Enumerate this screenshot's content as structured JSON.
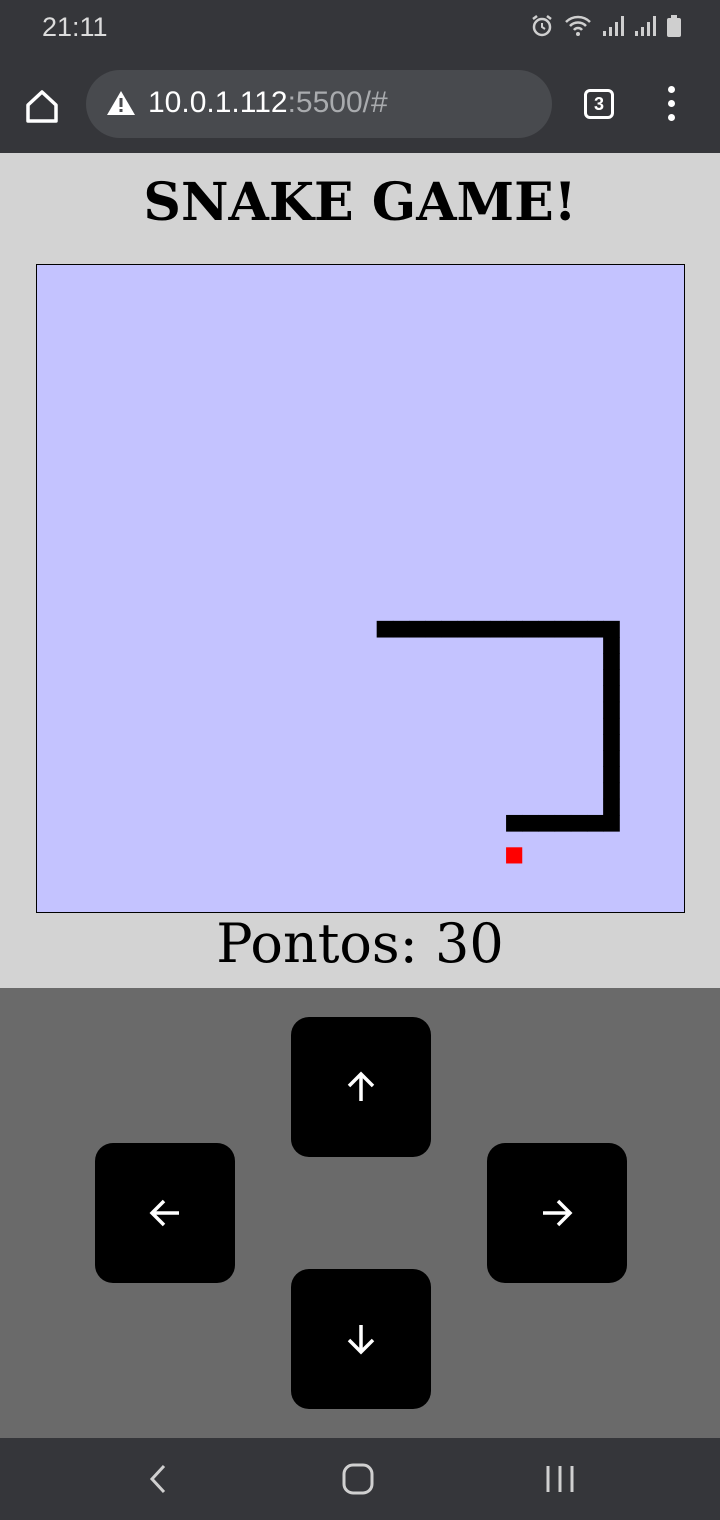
{
  "status_bar": {
    "time": "21:11",
    "icons": [
      "alarm-icon",
      "wifi-icon",
      "signal-icon",
      "signal-icon",
      "battery-icon"
    ]
  },
  "browser": {
    "url_host": "10.0.1.112",
    "url_rest": ":5500/#",
    "tab_count": "3"
  },
  "page": {
    "title": "SNAKE GAME!",
    "score_label": "Pontos: 30"
  },
  "game": {
    "grid_cells": 40,
    "snake": [
      [
        21,
        22
      ],
      [
        22,
        22
      ],
      [
        23,
        22
      ],
      [
        24,
        22
      ],
      [
        25,
        22
      ],
      [
        26,
        22
      ],
      [
        27,
        22
      ],
      [
        28,
        22
      ],
      [
        29,
        22
      ],
      [
        30,
        22
      ],
      [
        31,
        22
      ],
      [
        32,
        22
      ],
      [
        35,
        22
      ],
      [
        35,
        23
      ],
      [
        35,
        24
      ],
      [
        35,
        25
      ],
      [
        35,
        26
      ],
      [
        35,
        27
      ],
      [
        35,
        28
      ],
      [
        35,
        29
      ],
      [
        35,
        30
      ],
      [
        35,
        31
      ],
      [
        35,
        32
      ],
      [
        35,
        33
      ],
      [
        35,
        34
      ],
      [
        34,
        34
      ],
      [
        33,
        34
      ],
      [
        32,
        34
      ],
      [
        31,
        34
      ],
      [
        30,
        34
      ],
      [
        29,
        34
      ]
    ],
    "food": [
      29,
      36
    ],
    "colors": {
      "board": "#c4c3ff",
      "snake": "#000000",
      "food": "#ff0000"
    }
  },
  "controls": {
    "up_icon": "arrow-up-icon",
    "left_icon": "arrow-left-icon",
    "right_icon": "arrow-right-icon",
    "down_icon": "arrow-down-icon"
  },
  "nav_bar": {
    "icons": [
      "back-icon",
      "home-icon",
      "recent-apps-icon"
    ]
  }
}
